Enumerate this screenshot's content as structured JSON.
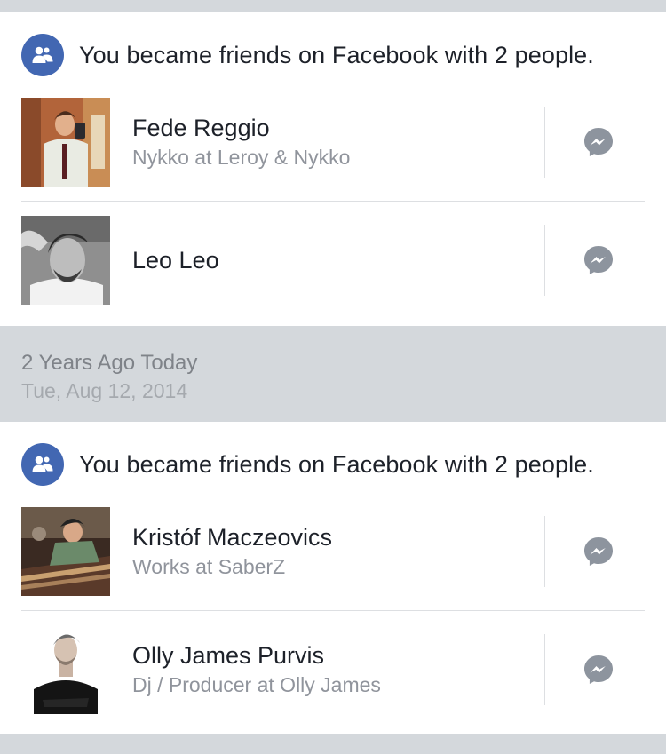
{
  "groups": [
    {
      "header": "You became friends on Facebook with 2 people.",
      "friends": [
        {
          "name": "Fede Reggio",
          "subtitle": "Nykko at Leroy & Nykko"
        },
        {
          "name": "Leo Leo",
          "subtitle": ""
        }
      ]
    },
    {
      "section_title": "2 Years Ago Today",
      "section_date": "Tue, Aug 12, 2014",
      "header": "You became friends on Facebook with 2 people.",
      "friends": [
        {
          "name": "Kristóf Maczeovics",
          "subtitle": "Works at SaberZ"
        },
        {
          "name": "Olly James Purvis",
          "subtitle": "Dj / Producer at Olly James"
        }
      ]
    }
  ],
  "colors": {
    "friends_icon_bg": "#4267b2",
    "messenger_icon": "#8d949e",
    "page_background": "#d4d8dc"
  },
  "icons": {
    "friends": "friends-icon",
    "messenger": "messenger-icon"
  }
}
